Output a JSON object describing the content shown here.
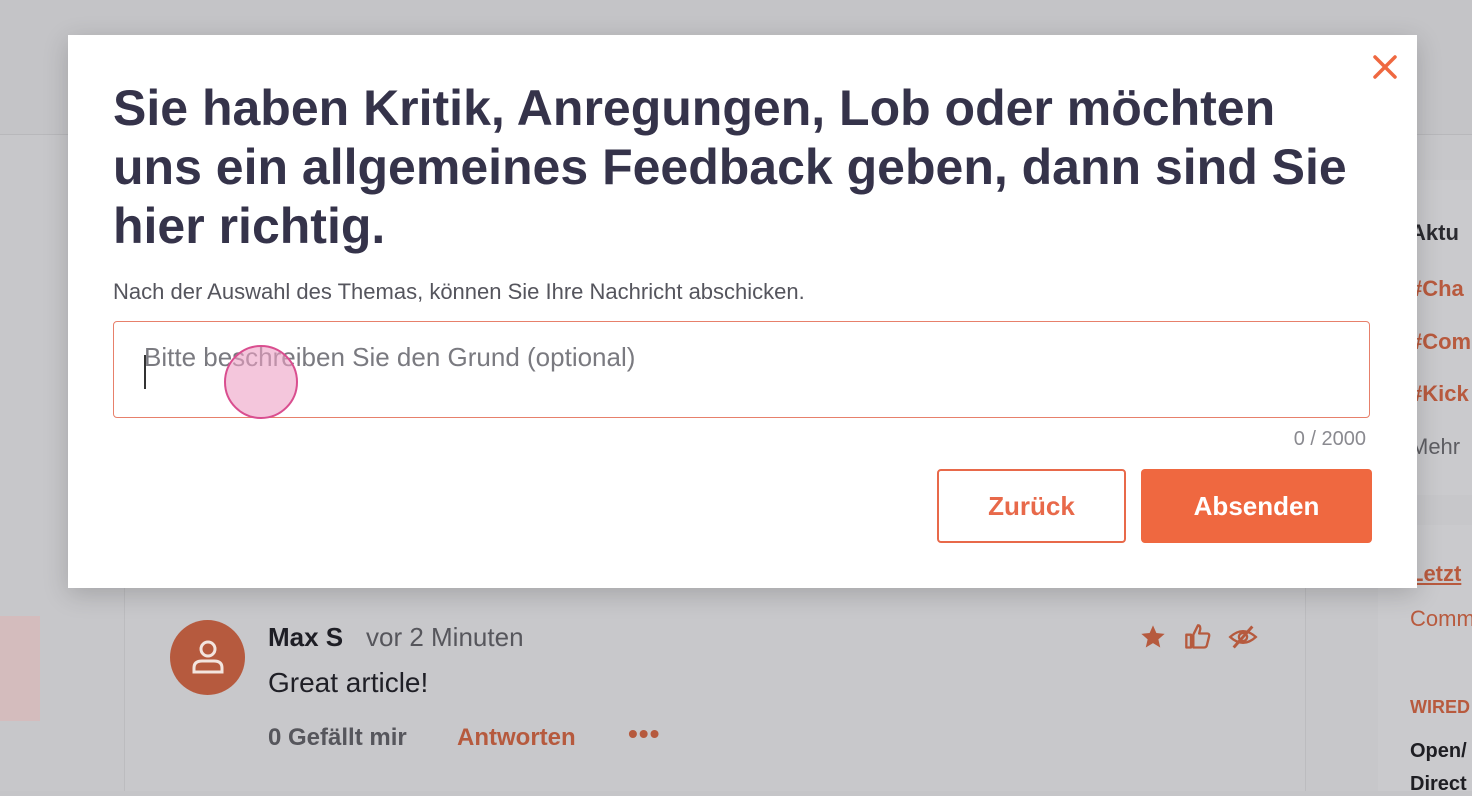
{
  "modal": {
    "title": "Sie haben Kritik, Anregungen, Lob oder möchten uns ein allgemeines Feedback geben, dann sind Sie hier richtig.",
    "subtitle": "Nach der Auswahl des Themas, können Sie Ihre Nachricht abschicken.",
    "textarea_placeholder": "Bitte beschreiben Sie den Grund (optional)",
    "textarea_value": "",
    "counter": "0 / 2000",
    "back_label": "Zurück",
    "send_label": "Absenden",
    "close_icon": "close-icon"
  },
  "colors": {
    "accent": "#ef6840",
    "title_text": "#35334a"
  },
  "comment": {
    "author": "Max S",
    "time": "vor 2 Minuten",
    "text": "Great article!",
    "likes": "0 Gefällt mir",
    "reply_label": "Antworten",
    "more_label": "•••",
    "icons": [
      "star-icon",
      "thumbs-up-icon",
      "hide-icon"
    ]
  },
  "sidebar": {
    "heading": "Aktu",
    "tags": [
      "#Cha",
      "#Com",
      "#Kick"
    ],
    "more": "Mehr",
    "latest_heading": "Letzt",
    "latest_sub": "Comm",
    "category": "WIRED",
    "article_line1": "Open/",
    "article_line2": "Direct"
  }
}
